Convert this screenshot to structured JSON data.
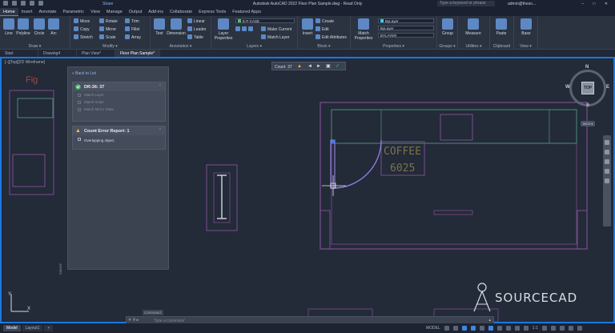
{
  "titlebar": {
    "share": "Share",
    "title": "Autodesk AutoCAD 2022   Floor Plan Sample.dwg - Read Only",
    "search": "Type a keyword or phrase",
    "user": "admin@theso...",
    "winbtns": "–  □  ✕"
  },
  "menu_tabs": [
    "Home",
    "Insert",
    "Annotate",
    "Parametric",
    "View",
    "Manage",
    "Output",
    "Add-ins",
    "Collaborate",
    "Express Tools",
    "Featured Apps"
  ],
  "ribbon": {
    "draw": {
      "label": "Draw ▾",
      "items": [
        "Line",
        "Polyline",
        "Circle",
        "Arc"
      ]
    },
    "modify": {
      "label": "Modify ▾",
      "items": [
        "Move",
        "Rotate",
        "Trim",
        "Copy",
        "Mirror",
        "Fillet",
        "Stretch",
        "Scale",
        "Array"
      ]
    },
    "annotation": {
      "label": "Annotation ▾",
      "text": "Text",
      "dimension": "Dimension",
      "items": [
        "Linear",
        "Leader",
        "Table"
      ]
    },
    "layers": {
      "label": "Layers ▾",
      "layer_properties": "Layer Properties",
      "current_layer": "E-F-CASE",
      "make_current": "Make Current",
      "match_layer": "Match Layer"
    },
    "block": {
      "label": "Block ▾",
      "insert": "Insert",
      "items": [
        "Create",
        "Edit",
        "Edit Attributes"
      ]
    },
    "properties": {
      "label": "Properties ▾",
      "match": "Match Properties",
      "color": "ByLayer",
      "linetype": "ByLayer",
      "lineweight": "BYLAYER"
    },
    "groups": {
      "label": "Groups ▾",
      "group": "Group"
    },
    "utilities": {
      "label": "Utilities ▾",
      "measure": "Measure"
    },
    "clipboard": {
      "label": "Clipboard",
      "paste": "Paste"
    },
    "view": {
      "label": "View ▾",
      "base": "Base"
    }
  },
  "file_tabs": [
    "Start",
    "Drawing4",
    "Plan View*",
    "Floor Plan Sample*"
  ],
  "viewport_label": "[–][Top][2D Wireframe]",
  "count_panel": {
    "back": "« Back to List",
    "item_title": "DR-36: 37",
    "options": [
      "Match Layer",
      "Match Scale",
      "Match Mirror State"
    ],
    "report_title": "Count Error Report: 1",
    "report_item": "Overlapping object",
    "side_label": "COUNT"
  },
  "count_toolbar": {
    "label": "Count",
    "value": "37"
  },
  "drawing": {
    "coffee": "COFFEE",
    "number": "6025",
    "brand": "SOURCECAD"
  },
  "navcube": {
    "top": "TOP",
    "n": "N",
    "s": "S",
    "e": "E",
    "w": "W",
    "wcs": "WCS ▾"
  },
  "command": {
    "title": "Command:",
    "placeholder": "Type a command"
  },
  "layout_tabs": [
    "Model",
    "Layout1",
    "+"
  ],
  "status": {
    "model": "MODEL",
    "scale": "1:1"
  },
  "colors": {
    "accent": "#1b78e2",
    "wall": "#7b4f8f",
    "furniture": "#4b8c7a",
    "door": "#8d7dd8",
    "label_red": "#a2464b"
  }
}
